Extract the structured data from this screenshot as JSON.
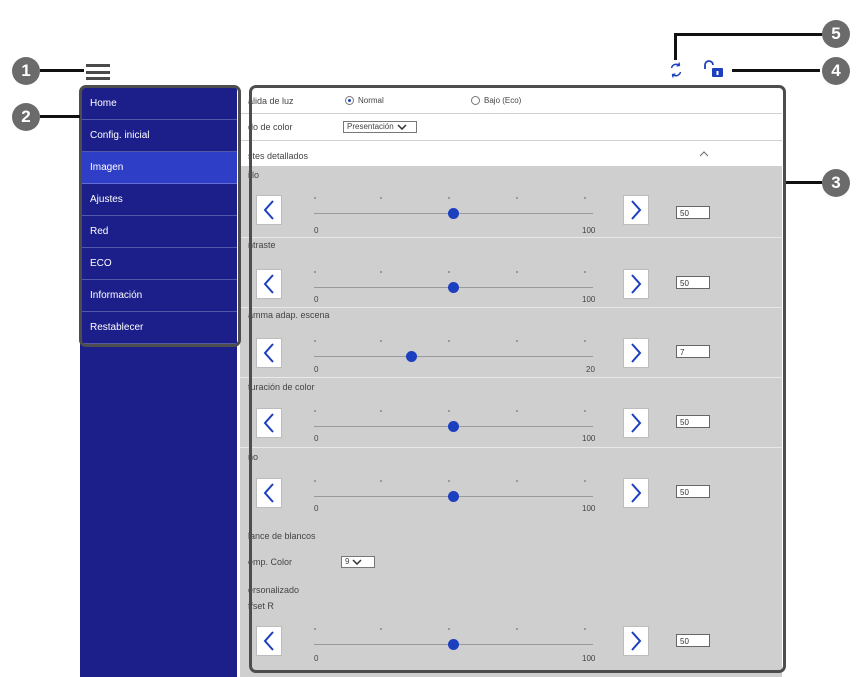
{
  "callouts": [
    "1",
    "2",
    "3",
    "4",
    "5"
  ],
  "nav": {
    "items": [
      {
        "label": "Home"
      },
      {
        "label": "Config. inicial"
      },
      {
        "label": "Imagen",
        "active": true
      },
      {
        "label": "Ajustes"
      },
      {
        "label": "Red"
      },
      {
        "label": "ECO"
      },
      {
        "label": "Información"
      },
      {
        "label": "Restablecer"
      }
    ]
  },
  "settings": {
    "light_output": {
      "label": "alida de luz",
      "option_normal": "Normal",
      "option_eco": "Bajo (Eco)",
      "selected": "Normal"
    },
    "color_mode": {
      "label": "do de color",
      "value": "Presentación"
    },
    "detailed": {
      "label": "stes detallados"
    },
    "brightness": {
      "label": "illo",
      "min": "0",
      "max": "100",
      "value": "50",
      "level": 50
    },
    "contrast": {
      "label": "ntraste",
      "min": "0",
      "max": "100",
      "value": "50",
      "level": 50
    },
    "gamma": {
      "label": "amma adap. escena",
      "min": "0",
      "max": "20",
      "value": "7",
      "level": 7
    },
    "saturation": {
      "label": "turación de color",
      "min": "0",
      "max": "100",
      "value": "50",
      "level": 50
    },
    "tint": {
      "label": "no",
      "min": "0",
      "max": "100",
      "value": "50",
      "level": 50
    },
    "white_balance": {
      "label": "lance de blancos"
    },
    "color_temp": {
      "label": "emp. Color",
      "value": "9"
    },
    "custom": {
      "label": "ersonalizado"
    },
    "offset_r": {
      "label": "ffset R",
      "min": "0",
      "max": "100",
      "value": "50",
      "level": 50
    }
  },
  "colors": {
    "sidebar": "#1c1f8a",
    "active": "#2f3ec6",
    "knob": "#1c3fbf",
    "panel": "#cfcfcf"
  },
  "icons": [
    "menu-icon",
    "refresh-icon",
    "unlock-icon",
    "chevron-up-icon",
    "arrow-left-icon",
    "arrow-right-icon"
  ]
}
